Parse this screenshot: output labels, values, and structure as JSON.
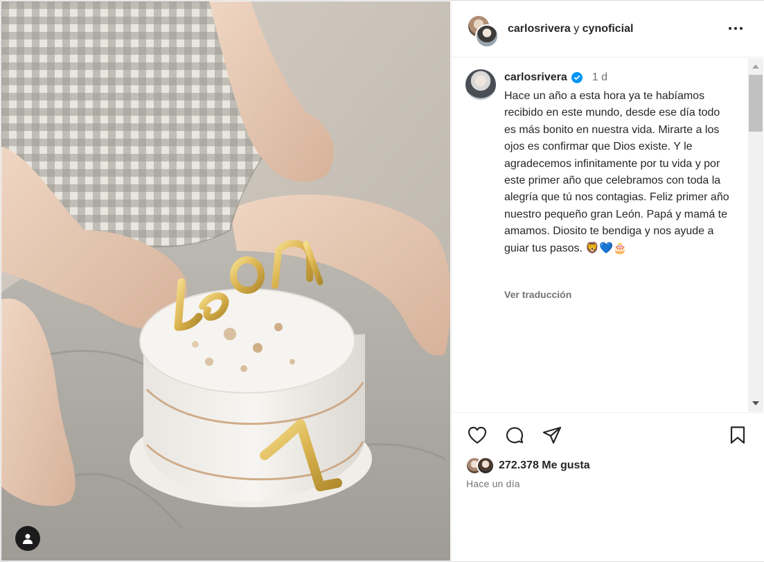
{
  "post": {
    "header": {
      "author": "carlosrivera",
      "connector": "y",
      "coauthor": "cynoficial",
      "more_icon": "more-horizontal-icon"
    },
    "caption": {
      "username": "carlosrivera",
      "verified": true,
      "time": "1 d",
      "text": "Hace un año a esta hora ya te habíamos recibido en este mundo, desde ese día todo es más bonito en nuestra vida. Mirarte a los ojos es confirmar que Dios existe. Y le agradecemos infinitamente por tu vida y por este primer año que celebramos con toda la alegría que tú nos contagias. Feliz primer año nuestro pequeño gran León. Papá y mamá te amamos. Diosito te bendiga y nos ayude a guiar tus pasos. 🦁💙🎂",
      "translate": "Ver traducción"
    },
    "actions": {
      "like_icon": "heart-icon",
      "comment_icon": "comment-icon",
      "share_icon": "send-icon",
      "save_icon": "bookmark-icon"
    },
    "likes": "272.378 Me gusta",
    "posted_ago": "Hace un día",
    "photo": {
      "cake_topper": "Leon",
      "tag_icon": "user-tag-icon"
    }
  },
  "colors": {
    "verified": "#0095f6",
    "secondary_text": "#737373",
    "primary_text": "#262626"
  }
}
